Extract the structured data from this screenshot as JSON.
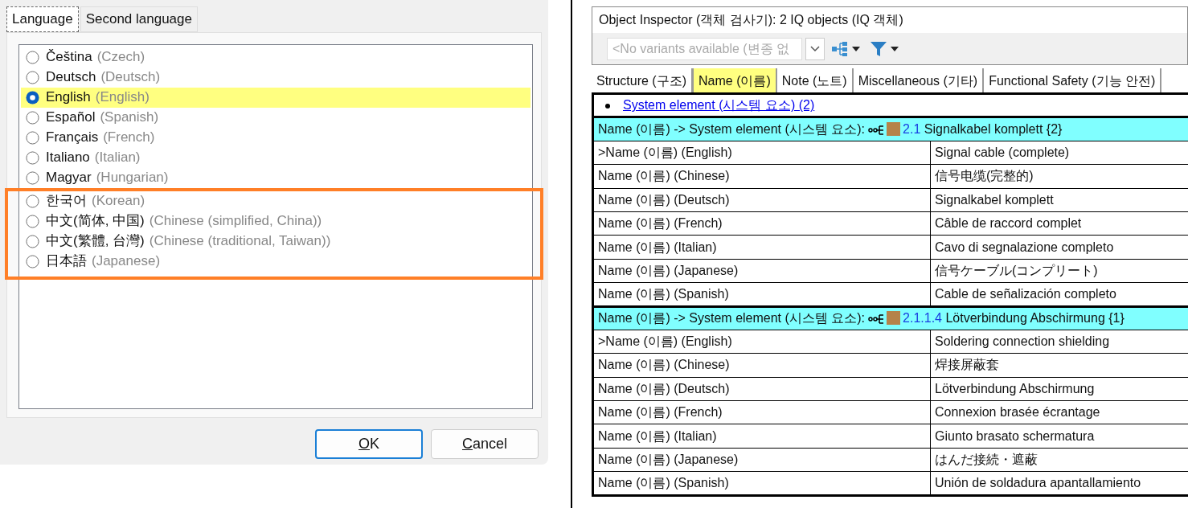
{
  "dialog": {
    "tabs": [
      {
        "label": "Language",
        "selected": true
      },
      {
        "label": "Second language",
        "selected": false
      }
    ],
    "languages": [
      {
        "name": "Čeština",
        "english": "(Czech)",
        "selected": false
      },
      {
        "name": "Deutsch",
        "english": "(Deutsch)",
        "selected": false
      },
      {
        "name": "English",
        "english": "(English)",
        "selected": true
      },
      {
        "name": "Español",
        "english": "(Spanish)",
        "selected": false
      },
      {
        "name": "Français",
        "english": "(French)",
        "selected": false
      },
      {
        "name": "Italiano",
        "english": "(Italian)",
        "selected": false
      },
      {
        "name": "Magyar",
        "english": "(Hungarian)",
        "selected": false
      }
    ],
    "highlighted_languages": [
      {
        "name": "한국어",
        "english": "(Korean)",
        "selected": false
      },
      {
        "name": "中文(简体, 中国)",
        "english": "(Chinese (simplified, China))",
        "selected": false
      },
      {
        "name": "中文(繁體, 台灣)",
        "english": "(Chinese (traditional, Taiwan))",
        "selected": false
      },
      {
        "name": "日本語",
        "english": "(Japanese)",
        "selected": false
      }
    ],
    "buttons": [
      {
        "label": "OK",
        "default": true
      },
      {
        "label": "Cancel",
        "default": false
      }
    ]
  },
  "inspector": {
    "title": "Object Inspector (객체 검사기): 2 IQ objects (IQ 객체)",
    "variant_field": {
      "placeholder": "<No variants available (변종 없"
    },
    "tabs": [
      {
        "label": "Structure (구조)",
        "selected": false
      },
      {
        "label": "Name (이름)",
        "selected": true
      },
      {
        "label": "Note (노트)",
        "selected": false
      },
      {
        "label": "Miscellaneous (기타)",
        "selected": false
      },
      {
        "label": "Functional Safety (기능 안전)",
        "selected": false
      }
    ],
    "link": "System element (시스템 요소) (2)",
    "groups": [
      {
        "header": "Name (이름) -> System element (시스템 요소):",
        "number": "2.1",
        "title": "Signalkabel komplett {2}",
        "color": "#b5834a",
        "rows": [
          {
            "property": ">Name (이름) (English)",
            "value": "Signal cable (complete)"
          },
          {
            "property": "Name (이름) (Chinese)",
            "value": "信号电缆(完整的)"
          },
          {
            "property": "Name (이름) (Deutsch)",
            "value": "Signalkabel komplett"
          },
          {
            "property": "Name (이름) (French)",
            "value": "Câble de raccord complet"
          },
          {
            "property": "Name (이름) (Italian)",
            "value": "Cavo di segnalazione completo"
          },
          {
            "property": "Name (이름) (Japanese)",
            "value": "信号ケーブル(コンプリート)"
          },
          {
            "property": "Name (이름) (Spanish)",
            "value": "Cable de señalización completo"
          }
        ]
      },
      {
        "header": "Name (이름) -> System element (시스템 요소):",
        "number": "2.1.1.4",
        "title": "Lötverbindung Abschirmung {1}",
        "color": "#b5834a",
        "rows": [
          {
            "property": ">Name (이름) (English)",
            "value": "Soldering connection shielding"
          },
          {
            "property": "Name (이름) (Chinese)",
            "value": "焊接屏蔽套"
          },
          {
            "property": "Name (이름) (Deutsch)",
            "value": "Lötverbindung Abschirmung"
          },
          {
            "property": "Name (이름) (French)",
            "value": "Connexion brasée écrantage"
          },
          {
            "property": "Name (이름) (Italian)",
            "value": "Giunto brasato schermatura"
          },
          {
            "property": "Name (이름) (Japanese)",
            "value": "はんだ接続・遮蔽"
          },
          {
            "property": "Name (이름) (Spanish)",
            "value": "Unión de soldadura apantallamiento"
          }
        ]
      }
    ]
  }
}
